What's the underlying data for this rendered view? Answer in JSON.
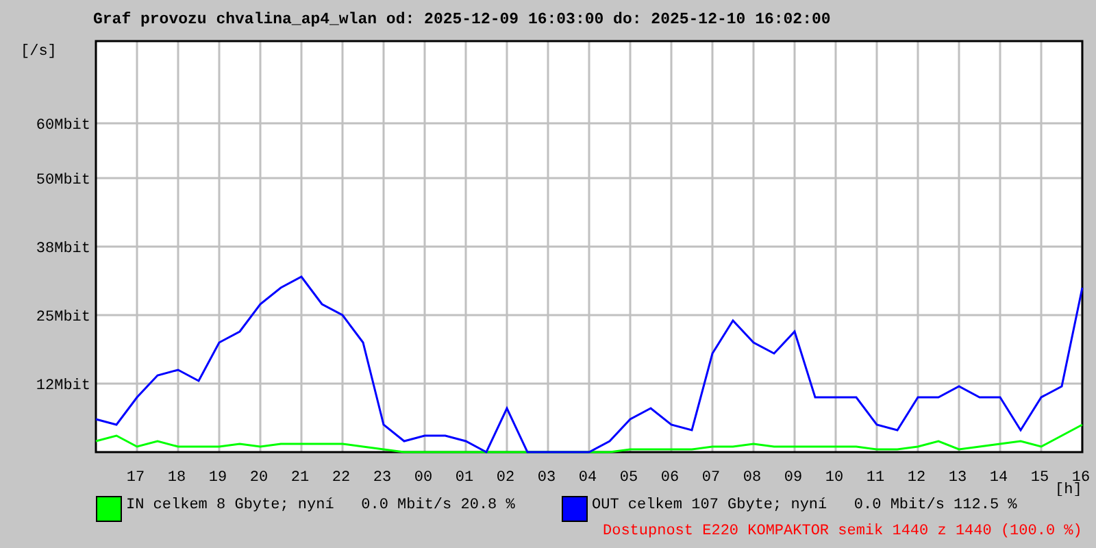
{
  "title": "Graf provozu chvalina_ap4_wlan od: 2025-12-09 16:03:00 do: 2025-12-10 16:02:00",
  "chart_data": {
    "type": "line",
    "ylabel": "[/s]",
    "xlabel": "[h]",
    "categories": [
      null,
      null,
      "17",
      null,
      "18",
      null,
      "19",
      null,
      "20",
      null,
      "21",
      null,
      "22",
      null,
      "23",
      null,
      "00",
      null,
      "01",
      null,
      "02",
      null,
      "03",
      null,
      "04",
      null,
      "05",
      null,
      "06",
      null,
      "07",
      null,
      "08",
      null,
      "09",
      null,
      "10",
      null,
      "11",
      null,
      "12",
      null,
      "13",
      null,
      "14",
      null,
      "15",
      null,
      "16"
    ],
    "series": [
      {
        "name": "IN",
        "color": "#00ff00",
        "values": [
          2,
          3,
          1,
          2,
          1,
          1,
          1,
          1.5,
          1,
          1.5,
          1.5,
          1.5,
          1.5,
          1,
          0.5,
          0,
          0,
          0,
          0,
          0,
          0,
          0,
          0,
          0,
          0,
          0,
          0.5,
          0.5,
          0.5,
          0.5,
          1,
          1,
          1.5,
          1,
          1,
          1,
          1,
          1,
          0.5,
          0.5,
          1,
          2,
          0.5,
          1,
          1.5,
          2,
          1,
          3,
          5
        ]
      },
      {
        "name": "OUT",
        "color": "#0000ff",
        "values": [
          6,
          5,
          10,
          14,
          15,
          13,
          20,
          22,
          27,
          30,
          32,
          27,
          25,
          20,
          5,
          2,
          3,
          3,
          2,
          0,
          8,
          0,
          0,
          0,
          0,
          2,
          6,
          8,
          5,
          4,
          18,
          24,
          20,
          18,
          22,
          10,
          10,
          10,
          5,
          4,
          10,
          10,
          12,
          10,
          10,
          4,
          10,
          12,
          30
        ]
      }
    ],
    "ylim": [
      0,
      75
    ],
    "grid": true,
    "yticks": [
      {
        "value": 12.5,
        "label": "12Mbit"
      },
      {
        "value": 25,
        "label": "25Mbit"
      },
      {
        "value": 37.5,
        "label": "38Mbit"
      },
      {
        "value": 50,
        "label": "50Mbit"
      },
      {
        "value": 60,
        "label": "60Mbit"
      }
    ]
  },
  "legend": [
    {
      "text": "celkem 8 Gbyte; nyní   0.0 Mbit/s 20.8 %"
    },
    {
      "text": "celkem 107 Gbyte; nyní   0.0 Mbit/s 112.5 %"
    }
  ],
  "availability": "Dostupnost E220 KOMPAKTOR semik 1440 z 1440 (100.0 %)"
}
